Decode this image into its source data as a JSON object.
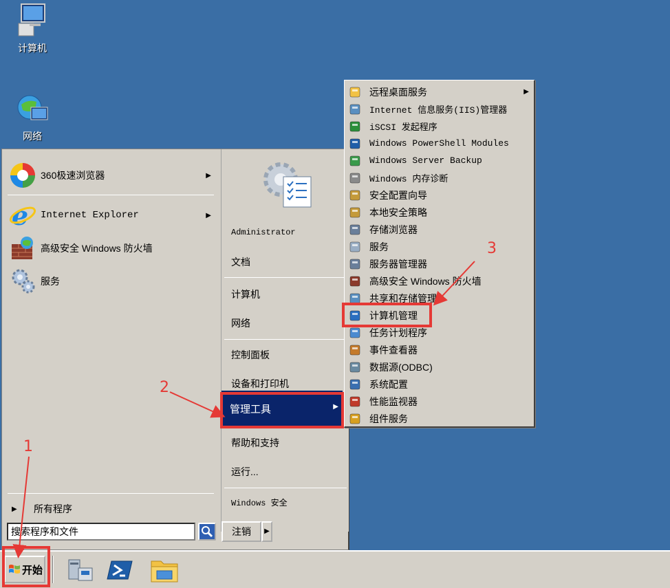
{
  "desktop": {
    "icons": [
      {
        "label": "计算机",
        "icon": "computer-icon"
      },
      {
        "label": "网络",
        "icon": "network-globe-icon"
      }
    ]
  },
  "start_menu": {
    "left_items": [
      {
        "label": "360极速浏览器",
        "icon": "360-browser-icon",
        "has_submenu": true
      },
      {
        "label": "Internet Explorer",
        "icon": "internet-explorer-icon",
        "has_submenu": true
      },
      {
        "label": "高级安全 Windows 防火墙",
        "icon": "firewall-icon",
        "has_submenu": false
      },
      {
        "label": "服务",
        "icon": "services-gear-icon",
        "has_submenu": false
      }
    ],
    "all_programs": "所有程序",
    "search_placeholder": "搜索程序和文件",
    "right_items": {
      "user": "Administrator",
      "documents": "文档",
      "computer": "计算机",
      "network": "网络",
      "control_panel": "控制面板",
      "devices_printers": "设备和打印机",
      "admin_tools": "管理工具",
      "help_support": "帮助和支持",
      "run": "运行...",
      "windows_security": "Windows 安全"
    },
    "logoff": "注销"
  },
  "submenu": {
    "items": [
      {
        "label": "远程桌面服务",
        "icon": "folder-icon",
        "has_submenu": true,
        "mono": false
      },
      {
        "label": "Internet 信息服务(IIS)管理器",
        "icon": "iis-icon",
        "mono": true
      },
      {
        "label": "iSCSI 发起程序",
        "icon": "iscsi-globe-icon",
        "mono": true
      },
      {
        "label": "Windows PowerShell Modules",
        "icon": "powershell-icon",
        "mono": true
      },
      {
        "label": "Windows Server Backup",
        "icon": "backup-icon",
        "mono": true
      },
      {
        "label": "Windows 内存诊断",
        "icon": "memory-diagnostic-icon",
        "mono": true
      },
      {
        "label": "安全配置向导",
        "icon": "security-wizard-icon",
        "mono": false
      },
      {
        "label": "本地安全策略",
        "icon": "local-security-policy-icon",
        "mono": false
      },
      {
        "label": "存储浏览器",
        "icon": "storage-explorer-icon",
        "mono": false
      },
      {
        "label": "服务",
        "icon": "services-icon",
        "mono": false
      },
      {
        "label": "服务器管理器",
        "icon": "server-manager-icon",
        "mono": false
      },
      {
        "label": "高级安全 Windows 防火墙",
        "icon": "firewall-icon",
        "mono": false
      },
      {
        "label": "共享和存储管理",
        "icon": "share-storage-icon",
        "mono": false
      },
      {
        "label": "计算机管理",
        "icon": "computer-management-icon",
        "mono": false
      },
      {
        "label": "任务计划程序",
        "icon": "task-scheduler-icon",
        "mono": false
      },
      {
        "label": "事件查看器",
        "icon": "event-viewer-icon",
        "mono": false
      },
      {
        "label": "数据源(ODBC)",
        "icon": "odbc-icon",
        "mono": false
      },
      {
        "label": "系统配置",
        "icon": "system-config-icon",
        "mono": false
      },
      {
        "label": "性能监视器",
        "icon": "performance-monitor-icon",
        "mono": false
      },
      {
        "label": "组件服务",
        "icon": "component-services-icon",
        "mono": false
      }
    ]
  },
  "taskbar": {
    "start_label": "开始",
    "pinned": [
      "server-manager-icon",
      "powershell-icon",
      "explorer-folder-icon"
    ]
  },
  "annotations": {
    "step1": "1",
    "step2": "2",
    "step3": "3",
    "color": "#e53935"
  }
}
